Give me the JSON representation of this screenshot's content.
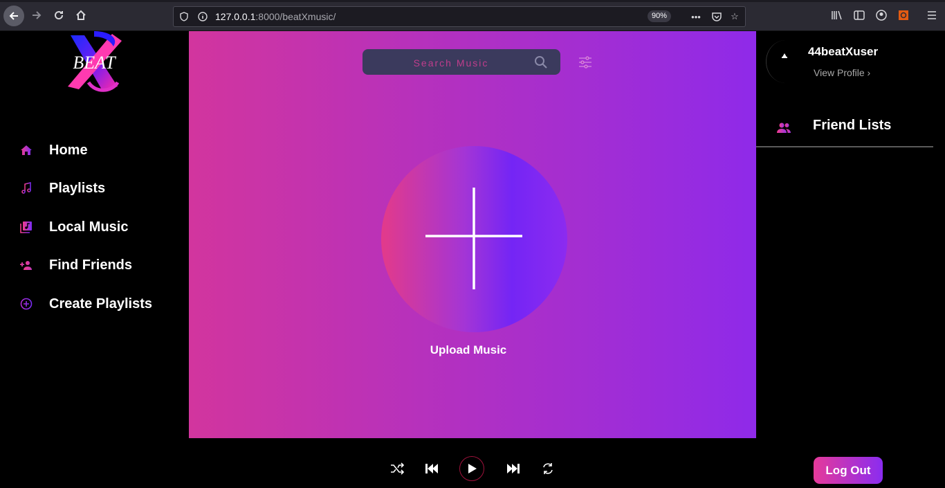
{
  "browser": {
    "url_host": "127.0.0.1",
    "url_path": ":8000/beatXmusic/",
    "zoom": "90%"
  },
  "brand": {
    "logo_text": "BEAT"
  },
  "sidebar": {
    "items": [
      {
        "label": "Home",
        "icon": "home-icon"
      },
      {
        "label": "Playlists",
        "icon": "music-note-icon"
      },
      {
        "label": "Local Music",
        "icon": "library-music-icon"
      },
      {
        "label": "Find Friends",
        "icon": "person-add-icon"
      },
      {
        "label": "Create Playlists",
        "icon": "add-circle-icon"
      }
    ]
  },
  "search": {
    "placeholder": "Search Music"
  },
  "upload": {
    "label": "Upload Music"
  },
  "profile": {
    "username": "44beatXuser",
    "view_profile": "View Profile ›"
  },
  "friends": {
    "title": "Friend Lists"
  },
  "player": {
    "logout_label": "Log Out"
  },
  "colors": {
    "accent_pink": "#d2359e",
    "accent_purple": "#8f2ae9",
    "background": "#000000"
  }
}
